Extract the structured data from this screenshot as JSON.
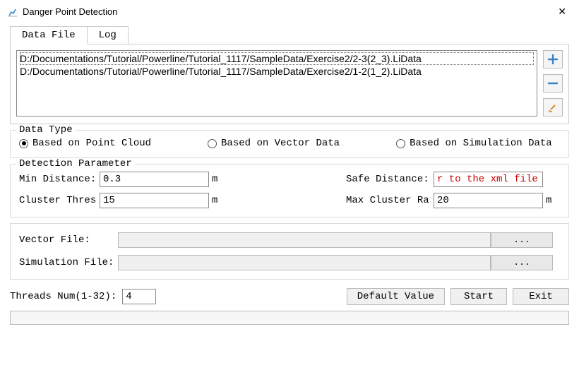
{
  "window": {
    "title": "Danger Point Detection"
  },
  "tabs": {
    "data_file": "Data File",
    "log": "Log"
  },
  "files": {
    "items": [
      "D:/Documentations/Tutorial/Powerline/Tutorial_1117/SampleData/Exercise2/2-3(2_3).LiData",
      "D:/Documentations/Tutorial/Powerline/Tutorial_1117/SampleData/Exercise2/1-2(1_2).LiData"
    ]
  },
  "data_type": {
    "legend": "Data Type",
    "opt_point_cloud": "Based on Point Cloud",
    "opt_vector": "Based on Vector Data",
    "opt_sim": "Based on Simulation Data",
    "selected": "point_cloud"
  },
  "detection": {
    "legend": "Detection Parameter",
    "min_dist_label": "Min Distance:",
    "min_dist_value": "0.3",
    "min_dist_unit": "m",
    "safe_dist_label": "Safe Distance:",
    "safe_dist_value": "r to the xml file!",
    "cluster_thresh_label": "Cluster Threshold:",
    "cluster_thresh_value": "15",
    "cluster_thresh_unit": "m",
    "max_cluster_label": "Max Cluster Radius:",
    "max_cluster_value": "20",
    "max_cluster_unit": "m"
  },
  "files_out": {
    "vector_label": "Vector File:",
    "vector_value": "",
    "sim_label": "Simulation File:",
    "sim_value": "",
    "browse": "..."
  },
  "bottom": {
    "threads_label": "Threads Num(1-32):",
    "threads_value": "4",
    "default_value": "Default Value",
    "start": "Start",
    "exit": "Exit"
  },
  "icons": {
    "plus": "plus",
    "minus": "minus",
    "folder": "folder"
  }
}
